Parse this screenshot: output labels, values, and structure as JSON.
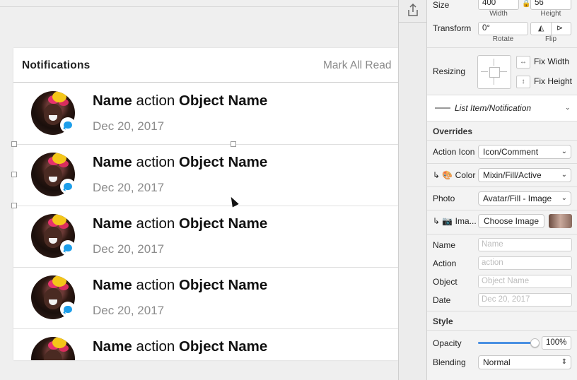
{
  "canvas": {
    "header": {
      "title": "Notifications",
      "mark_all": "Mark All Read"
    },
    "rows": [
      {
        "name": "Name",
        "action": "action",
        "object": "Object Name",
        "date": "Dec 20, 2017"
      },
      {
        "name": "Name",
        "action": "action",
        "object": "Object Name",
        "date": "Dec 20, 2017"
      },
      {
        "name": "Name",
        "action": "action",
        "object": "Object Name",
        "date": "Dec 20, 2017"
      },
      {
        "name": "Name",
        "action": "action",
        "object": "Object Name",
        "date": "Dec 20, 2017"
      },
      {
        "name": "Name",
        "action": "action",
        "object": "Object Name",
        "date": ""
      }
    ]
  },
  "inspector": {
    "size": {
      "label": "Size",
      "width": "400",
      "height": "56",
      "width_caption": "Width",
      "height_caption": "Height"
    },
    "transform": {
      "label": "Transform",
      "rotate": "0°",
      "rotate_caption": "Rotate",
      "flip_caption": "Flip"
    },
    "resizing": {
      "label": "Resizing",
      "fix_width": "Fix Width",
      "fix_height": "Fix Height"
    },
    "symbol": {
      "name": "List Item/Notification"
    },
    "overrides": {
      "title": "Overrides",
      "action_icon": {
        "label": "Action Icon",
        "value": "Icon/Comment"
      },
      "color": {
        "label": "↳ 🎨 Color",
        "value": "Mixin/Fill/Active"
      },
      "photo": {
        "label": "Photo",
        "value": "Avatar/Fill - Image"
      },
      "image": {
        "label": "↳ 📷 Ima...",
        "button": "Choose Image"
      },
      "name": {
        "label": "Name",
        "placeholder": "Name"
      },
      "action": {
        "label": "Action",
        "placeholder": "action"
      },
      "object": {
        "label": "Object",
        "placeholder": "Object Name"
      },
      "date": {
        "label": "Date",
        "placeholder": "Dec 20, 2017"
      }
    },
    "style": {
      "title": "Style",
      "opacity": {
        "label": "Opacity",
        "value": "100%",
        "level": 1.0
      },
      "blending": {
        "label": "Blending",
        "value": "Normal"
      }
    }
  },
  "colors": {
    "accent": "#1c9eea",
    "slider": "#4a90e2"
  }
}
